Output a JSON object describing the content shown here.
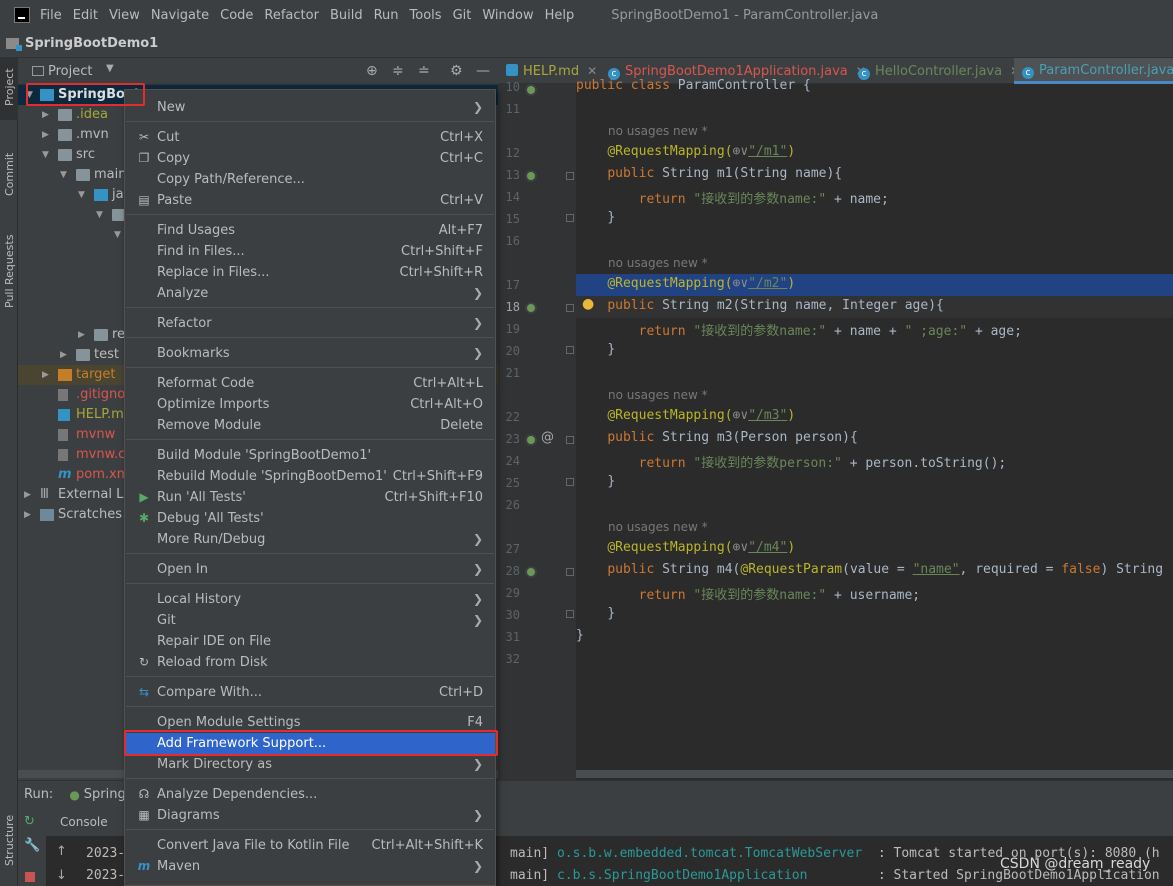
{
  "menubar": {
    "items": [
      "File",
      "Edit",
      "View",
      "Navigate",
      "Code",
      "Refactor",
      "Build",
      "Run",
      "Tools",
      "Git",
      "Window",
      "Help"
    ],
    "window_title": "SpringBootDemo1 - ParamController.java"
  },
  "breadcrumb": {
    "project": "SpringBootDemo1"
  },
  "left_strip": {
    "project": "Project",
    "commit": "Commit",
    "pull_requests": "Pull Requests",
    "structure": "Structure"
  },
  "project_panel": {
    "title": "Project",
    "tree": {
      "root": "SpringBoot",
      "idea": ".idea",
      "mvn": ".mvn",
      "src": "src",
      "main": "main",
      "java": "ja",
      "resources": "re",
      "test": "test",
      "target": "target",
      "gitignore": ".gitignor",
      "helpmd": "HELP.mc",
      "mvnw": "mvnw",
      "mvnwcmd": "mvnw.cn",
      "pom": "pom.xm",
      "external": "External Lib",
      "scratches": "Scratches a"
    }
  },
  "editor_tabs": [
    {
      "label": "HELP.md",
      "color": "#6a8759"
    },
    {
      "label": "SpringBootDemo1Application.java",
      "color": "#d9564e"
    },
    {
      "label": "HelloController.java",
      "color": "#6a8759"
    },
    {
      "label": "ParamController.java",
      "color": "#4a9fb5"
    }
  ],
  "editor": {
    "line_numbers": [
      "10",
      "11",
      "12",
      "13",
      "14",
      "15",
      "16",
      "17",
      "18",
      "19",
      "20",
      "21",
      "22",
      "23",
      "24",
      "25",
      "26",
      "27",
      "28",
      "29",
      "30",
      "31",
      "32"
    ],
    "hint": "no usages   new *",
    "l10": "public class ParamController {",
    "ann_prefix": "@RequestMapping(",
    "m1_path": "\"/m1\"",
    "m2_path": "\"/m2\"",
    "m3_path": "\"/m3\"",
    "m4_path": "\"/m4\"",
    "public": "public",
    "return": "return",
    "l13_rest": " String m1(String name){",
    "l14_str": "\"接收到的参数name:\"",
    "l14_rest": " + name;",
    "l18_rest": " String m2(String name, Integer age){",
    "l19_str1": "\"接收到的参数name:\"",
    "l19_mid": " + name + ",
    "l19_str2": "\" ;age:\"",
    "l19_rest": " + age;",
    "l23_rest": " String m3(Person person){",
    "l24_str": "\"接收到的参数person:\"",
    "l24_rest": " + person.toString();",
    "l28_a": " String m4(",
    "l28_ann": "@RequestParam",
    "l28_b": "(value = ",
    "l28_name": "\"name\"",
    "l28_c": ", required = ",
    "l28_false": "false",
    "l28_d": ") String",
    "l29_str": "\"接收到的参数name:\"",
    "l29_rest": " + username;",
    "close_brace": "}",
    "close_paren": ")",
    "globe": "⊕∨"
  },
  "run_panel": {
    "run_label": "Run:",
    "config": "Spring",
    "console_tab": "Console",
    "lines": [
      {
        "date": "2023-",
        "thread": "main]",
        "cls": "o.s.b.w.embedded.tomcat.TomcatWebServer",
        "msg": "  : Tomcat started on port(s): 8080 (h"
      },
      {
        "date": "2023-",
        "thread": "main]",
        "cls": "c.b.s.SpringBootDemo1Application",
        "msg": "         : Started SpringBootDemo1Application"
      }
    ]
  },
  "context_menu": {
    "new": "New",
    "cut": "Cut",
    "cut_sc": "Ctrl+X",
    "copy": "Copy",
    "copy_sc": "Ctrl+C",
    "copy_path": "Copy Path/Reference...",
    "paste": "Paste",
    "paste_sc": "Ctrl+V",
    "find_usages": "Find Usages",
    "find_usages_sc": "Alt+F7",
    "find_in_files": "Find in Files...",
    "find_in_files_sc": "Ctrl+Shift+F",
    "replace_in_files": "Replace in Files...",
    "replace_in_files_sc": "Ctrl+Shift+R",
    "analyze": "Analyze",
    "refactor": "Refactor",
    "bookmarks": "Bookmarks",
    "reformat": "Reformat Code",
    "reformat_sc": "Ctrl+Alt+L",
    "optimize": "Optimize Imports",
    "optimize_sc": "Ctrl+Alt+O",
    "remove_module": "Remove Module",
    "remove_module_sc": "Delete",
    "build_module": "Build Module 'SpringBootDemo1'",
    "rebuild_module": "Rebuild Module 'SpringBootDemo1'",
    "rebuild_module_sc": "Ctrl+Shift+F9",
    "run_tests": "Run 'All Tests'",
    "run_tests_sc": "Ctrl+Shift+F10",
    "debug_tests": "Debug 'All Tests'",
    "more_run": "More Run/Debug",
    "open_in": "Open In",
    "local_history": "Local History",
    "git": "Git",
    "repair_ide": "Repair IDE on File",
    "reload": "Reload from Disk",
    "compare": "Compare With...",
    "compare_sc": "Ctrl+D",
    "module_settings": "Open Module Settings",
    "module_settings_sc": "F4",
    "add_framework": "Add Framework Support...",
    "mark_directory": "Mark Directory as",
    "analyze_deps": "Analyze Dependencies...",
    "diagrams": "Diagrams",
    "convert_kotlin": "Convert Java File to Kotlin File",
    "convert_kotlin_sc": "Ctrl+Alt+Shift+K",
    "maven": "Maven"
  },
  "watermark": "CSDN @dream_ready"
}
